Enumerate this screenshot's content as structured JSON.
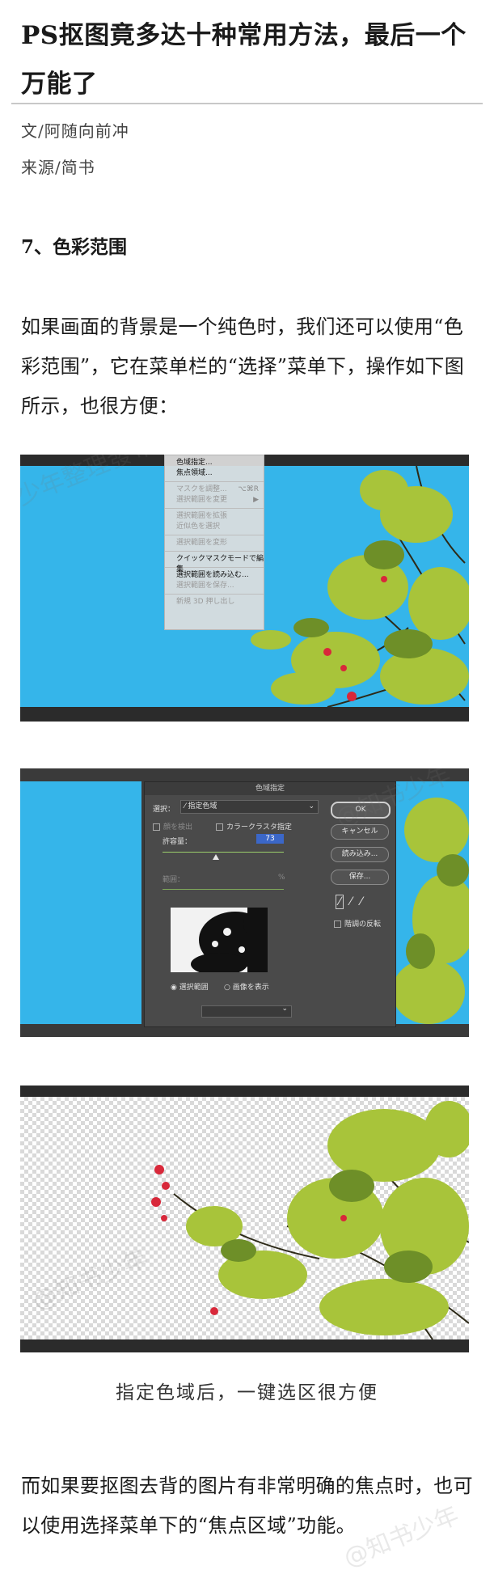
{
  "article": {
    "title": "PS抠图竟多达十种常用方法，最后一个万能了",
    "author_line": "文/阿随向前冲",
    "source_line": "来源/简书",
    "section_heading": "7、色彩范围",
    "paragraph_1": "如果画面的背景是一个纯色时，我们还可以使用“色彩范围”，它在菜单栏的“选择”菜单下，操作如下图所示，也很方便：",
    "caption_1": "指定色域后，一键选区很方便",
    "paragraph_2": "而如果要抠图去背的图片有非常明确的焦点时，也可以使用选择菜单下的“焦点区域”功能。"
  },
  "select_menu": {
    "items": [
      {
        "label": "色域指定...",
        "enabled": true
      },
      {
        "label": "焦点領域...",
        "enabled": true
      },
      {
        "label": "マスクを調整...",
        "enabled": false,
        "shortcut": "⌥⌘R"
      },
      {
        "label": "選択範囲を変更",
        "enabled": false,
        "shortcut": "▶"
      },
      {
        "label": "選択範囲を拡張",
        "enabled": false
      },
      {
        "label": "近似色を選択",
        "enabled": false
      },
      {
        "label": "選択範囲を変形",
        "enabled": false
      },
      {
        "label": "クイックマスクモードで編集",
        "enabled": true
      },
      {
        "label": "選択範囲を読み込む...",
        "enabled": true
      },
      {
        "label": "選択範囲を保存...",
        "enabled": false
      },
      {
        "label": "新規 3D 押し出し",
        "enabled": false
      }
    ]
  },
  "color_range_dialog": {
    "title": "色域指定",
    "select_label": "選択：",
    "select_value": "指定色域",
    "detect_faces_label": "顔を検出",
    "localized_clusters_label": "カラークラスタ指定",
    "fuzziness_label": "許容量：",
    "fuzziness_value": "73",
    "range_label": "範囲：",
    "range_unit": "%",
    "radio_selection": "選択範囲",
    "radio_image": "画像を表示",
    "ok_button": "OK",
    "cancel_button": "キャンセル",
    "load_button": "読み込み...",
    "save_button": "保存...",
    "invert_label": "階調の反転"
  },
  "watermarks": [
    "少年整理發布",
    "@知书少年",
    "@知书少年",
    "@知书少年"
  ],
  "colors": {
    "sky": "#35b5ea",
    "dark_bar": "#2b2b2b",
    "dialog_bg": "#4a4a4a",
    "foliage": "#a8c43a",
    "berries": "#d8283a"
  }
}
